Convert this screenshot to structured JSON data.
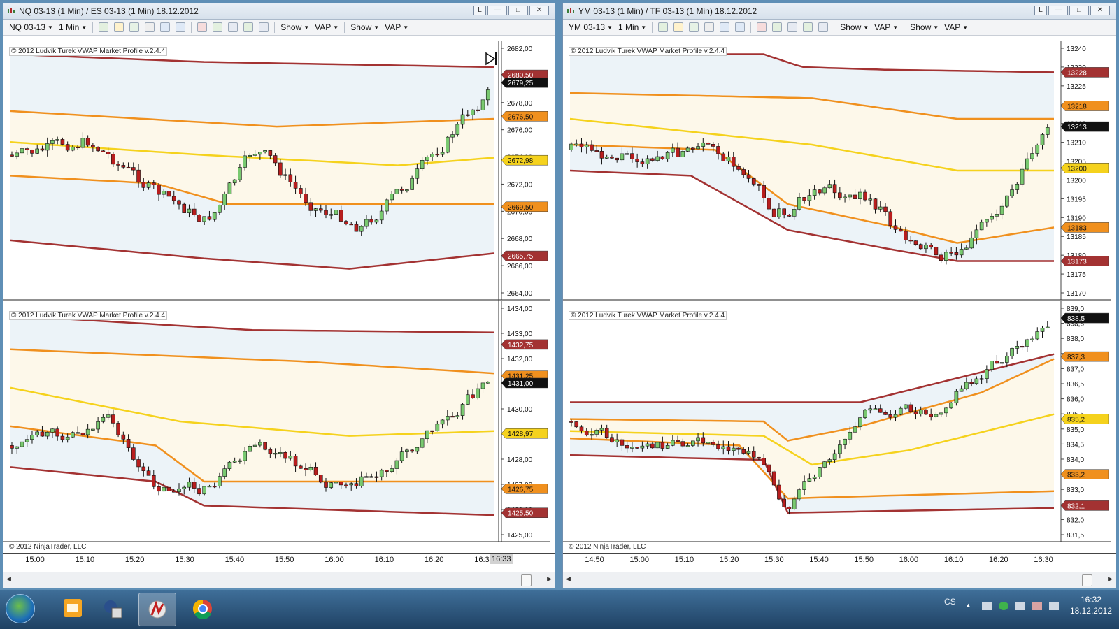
{
  "windows": [
    {
      "id": "left",
      "title": "NQ 03-13 (1 Min) / ES 03-13 (1 Min)  18.12.2012",
      "toolbar": {
        "instrument": "NQ 03-13",
        "interval": "1 Min",
        "show1": "Show",
        "vap1": "VAP",
        "show2": "Show",
        "vap2": "VAP"
      },
      "window_buttons": [
        "L",
        "",
        "",
        ""
      ],
      "panels": [
        {
          "copyright": "© 2012 Ludvik Turek VWAP Market Profile v.2.4.4",
          "y_ticks": [
            "2682,00",
            "2680,00",
            "2678,00",
            "2676,00",
            "2674,00",
            "2672,00",
            "2670,00",
            "2668,00",
            "2666,00",
            "2664,00"
          ],
          "price_tags": [
            {
              "label": "2680,50",
              "color": "#a33232"
            },
            {
              "label": "2679,25",
              "color": "#111111"
            },
            {
              "label": "2676,50",
              "color": "#f0901e"
            },
            {
              "label": "2672,98",
              "color": "#f5d21d"
            },
            {
              "label": "2669,50",
              "color": "#f0901e"
            },
            {
              "label": "2665,75",
              "color": "#a33232"
            }
          ],
          "ninja": ""
        },
        {
          "copyright": "© 2012 Ludvik Turek VWAP Market Profile v.2.4.4",
          "y_ticks": [
            "1434,00",
            "1433,00",
            "1432,00",
            "1431,00",
            "1430,00",
            "1429,00",
            "1428,00",
            "1427,00",
            "1426,00",
            "1425,00"
          ],
          "price_tags": [
            {
              "label": "1432,75",
              "color": "#a33232"
            },
            {
              "label": "1431,25",
              "color": "#f0901e"
            },
            {
              "label": "1431,00",
              "color": "#111111"
            },
            {
              "label": "1428,97",
              "color": "#f5d21d"
            },
            {
              "label": "1426,75",
              "color": "#f0901e"
            },
            {
              "label": "1425,50",
              "color": "#a33232"
            }
          ],
          "ninja": "© 2012 NinjaTrader, LLC"
        }
      ],
      "x_labels": [
        "15:00",
        "15:10",
        "15:20",
        "15:30",
        "15:40",
        "15:50",
        "16:00",
        "16:10",
        "16:20",
        "16:30"
      ],
      "x_current": "16:33"
    },
    {
      "id": "right",
      "title": "YM 03-13 (1 Min) / TF 03-13 (1 Min)  18.12.2012",
      "toolbar": {
        "instrument": "YM 03-13",
        "interval": "1 Min",
        "show1": "Show",
        "vap1": "VAP",
        "show2": "Show",
        "vap2": "VAP"
      },
      "window_buttons": [
        "L",
        "",
        "",
        ""
      ],
      "panels": [
        {
          "copyright": "© 2012 Ludvik Turek VWAP Market Profile v.2.4.4",
          "y_ticks": [
            "13240",
            "13230",
            "13225",
            "13220",
            "13215",
            "13210",
            "13205",
            "13200",
            "13195",
            "13190",
            "13185",
            "13180",
            "13175",
            "13170"
          ],
          "price_tags": [
            {
              "label": "13228",
              "color": "#a33232"
            },
            {
              "label": "13218",
              "color": "#f0901e"
            },
            {
              "label": "13213",
              "color": "#111111"
            },
            {
              "label": "13200",
              "color": "#f5d21d"
            },
            {
              "label": "13183",
              "color": "#f0901e"
            },
            {
              "label": "13173",
              "color": "#a33232"
            }
          ],
          "ninja": ""
        },
        {
          "copyright": "© 2012 Ludvik Turek VWAP Market Profile v.2.4.4",
          "y_ticks": [
            "839,0",
            "838,5",
            "838,0",
            "837,5",
            "837,0",
            "836,5",
            "836,0",
            "835,5",
            "835,0",
            "834,5",
            "834,0",
            "833,5",
            "833,0",
            "832,5",
            "832,0",
            "831,5"
          ],
          "price_tags": [
            {
              "label": "838,5",
              "color": "#111111"
            },
            {
              "label": "837,3",
              "color": "#f0901e"
            },
            {
              "label": "835,2",
              "color": "#f5d21d"
            },
            {
              "label": "833,2",
              "color": "#f0901e"
            },
            {
              "label": "832,1",
              "color": "#a33232"
            }
          ],
          "ninja": "© 2012 NinjaTrader, LLC"
        }
      ],
      "x_labels": [
        "14:50",
        "15:00",
        "15:10",
        "15:20",
        "15:30",
        "15:40",
        "15:50",
        "16:00",
        "16:10",
        "16:20",
        "16:30"
      ],
      "x_current": ""
    }
  ],
  "colors": {
    "band_outer": "#ecf3f8",
    "band_inner": "#fdf8ea",
    "outer_line": "#a33232",
    "inner_line": "#f0901e",
    "vwap_line": "#f5d21d",
    "bull": "#79c970",
    "bear": "#b81e1e"
  },
  "taskbar": {
    "apps": [
      "windows-start",
      "outlook",
      "ninjatrader-control",
      "ninjatrader-chart",
      "chrome"
    ],
    "lang": "CS",
    "time": "16:32",
    "date": "18.12.2012"
  }
}
